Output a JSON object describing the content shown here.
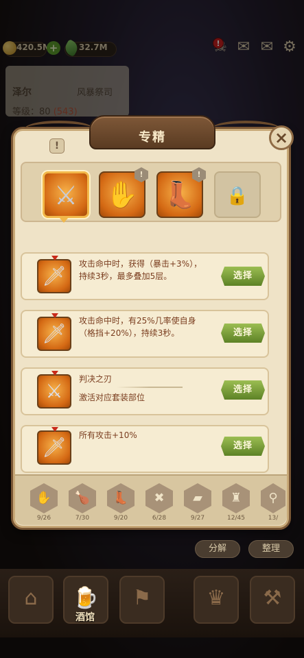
{
  "resources": {
    "gold": "420.5M",
    "gems": "32.7M"
  },
  "hero": {
    "name": "泽尔",
    "class": "风暴祭司",
    "level_label": "等级：80",
    "level_bonus": "(543)"
  },
  "modal": {
    "title": "专精",
    "close_icon": "close-icon",
    "info_icon": "info-icon"
  },
  "slots": [
    {
      "icon": "sword-icon",
      "selected": true
    },
    {
      "icon": "gauntlet-icon",
      "badge": "!"
    },
    {
      "icon": "boots-icon",
      "badge": "!"
    },
    {
      "icon": "lock-icon",
      "locked": true
    }
  ],
  "options": [
    {
      "text": "攻击命中时，获得（暴击+3%），持续3秒，最多叠加5层。",
      "button": "选择"
    },
    {
      "text": "攻击命中时，有25%几率使自身（格挡+20%），持续3秒。",
      "button": "选择"
    },
    {
      "text": "判决之刃",
      "sub": "激活对应套装部位",
      "button": "选择"
    },
    {
      "text": "所有攻击+10%",
      "button": "选择"
    }
  ],
  "categories": [
    {
      "icon": "gauntlet-icon",
      "count": "9/26"
    },
    {
      "icon": "leg-icon",
      "count": "7/30"
    },
    {
      "icon": "boot-icon",
      "count": "9/20"
    },
    {
      "icon": "cross-icon",
      "count": "6/28"
    },
    {
      "icon": "book-icon",
      "count": "9/27"
    },
    {
      "icon": "helmet-icon",
      "count": "12/45"
    },
    {
      "icon": "search-icon",
      "count": "13/"
    }
  ],
  "bottom": {
    "decompose": "分解",
    "organize": "整理"
  },
  "nav": {
    "tavern": "酒馆"
  },
  "colors": {
    "accent_green": "#6f952f",
    "panel": "#efe3c7",
    "text_brown": "#7a3d1f"
  }
}
